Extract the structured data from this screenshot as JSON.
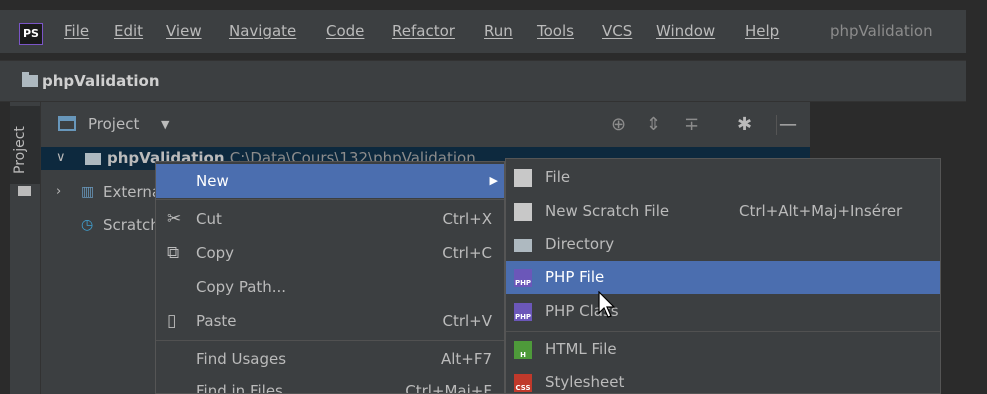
{
  "app": {
    "logo": "PS",
    "project_title": "phpValidation"
  },
  "menubar": {
    "items": [
      "File",
      "Edit",
      "View",
      "Navigate",
      "Code",
      "Refactor",
      "Run",
      "Tools",
      "VCS",
      "Window",
      "Help"
    ]
  },
  "breadcrumb": {
    "label": "phpValidation"
  },
  "stripe": {
    "project_tab": "Project"
  },
  "project_panel": {
    "title": "Project",
    "tree": {
      "root_name": "phpValidation",
      "root_path": "C:\\Data\\Cours\\132\\phpValidation",
      "external_libraries": "External Libraries",
      "scratches": "Scratches and Consoles"
    }
  },
  "context_menu": {
    "items": [
      {
        "label": "New",
        "shortcut": "",
        "icon": "",
        "active": true
      },
      {
        "label": "Cut",
        "shortcut": "Ctrl+X",
        "icon": "scissors-icon"
      },
      {
        "label": "Copy",
        "shortcut": "Ctrl+C",
        "icon": "copy-icon"
      },
      {
        "label": "Copy Path...",
        "shortcut": "",
        "icon": ""
      },
      {
        "label": "Paste",
        "shortcut": "Ctrl+V",
        "icon": "clipboard-icon"
      },
      {
        "label": "Find Usages",
        "shortcut": "Alt+F7",
        "icon": ""
      },
      {
        "label": "Find in Files...",
        "shortcut": "Ctrl+Maj+F",
        "icon": ""
      }
    ]
  },
  "submenu": {
    "items": [
      {
        "label": "File",
        "shortcut": "",
        "icon": "file-icon"
      },
      {
        "label": "New Scratch File",
        "shortcut": "Ctrl+Alt+Maj+Insérer",
        "icon": "scratch-file-icon"
      },
      {
        "label": "Directory",
        "shortcut": "",
        "icon": "folder-icon"
      },
      {
        "label": "PHP File",
        "shortcut": "",
        "icon": "php-file-icon",
        "active": true
      },
      {
        "label": "PHP Class",
        "shortcut": "",
        "icon": "php-class-icon"
      },
      {
        "label": "HTML File",
        "shortcut": "",
        "icon": "html-file-icon"
      },
      {
        "label": "Stylesheet",
        "shortcut": "",
        "icon": "stylesheet-icon"
      }
    ],
    "badges": {
      "php": "PHP",
      "html": "H",
      "css": "CSS"
    }
  },
  "colors": {
    "selection": "#4b6eaf",
    "background": "#3c3f41",
    "tree_selection": "#0d293e"
  }
}
